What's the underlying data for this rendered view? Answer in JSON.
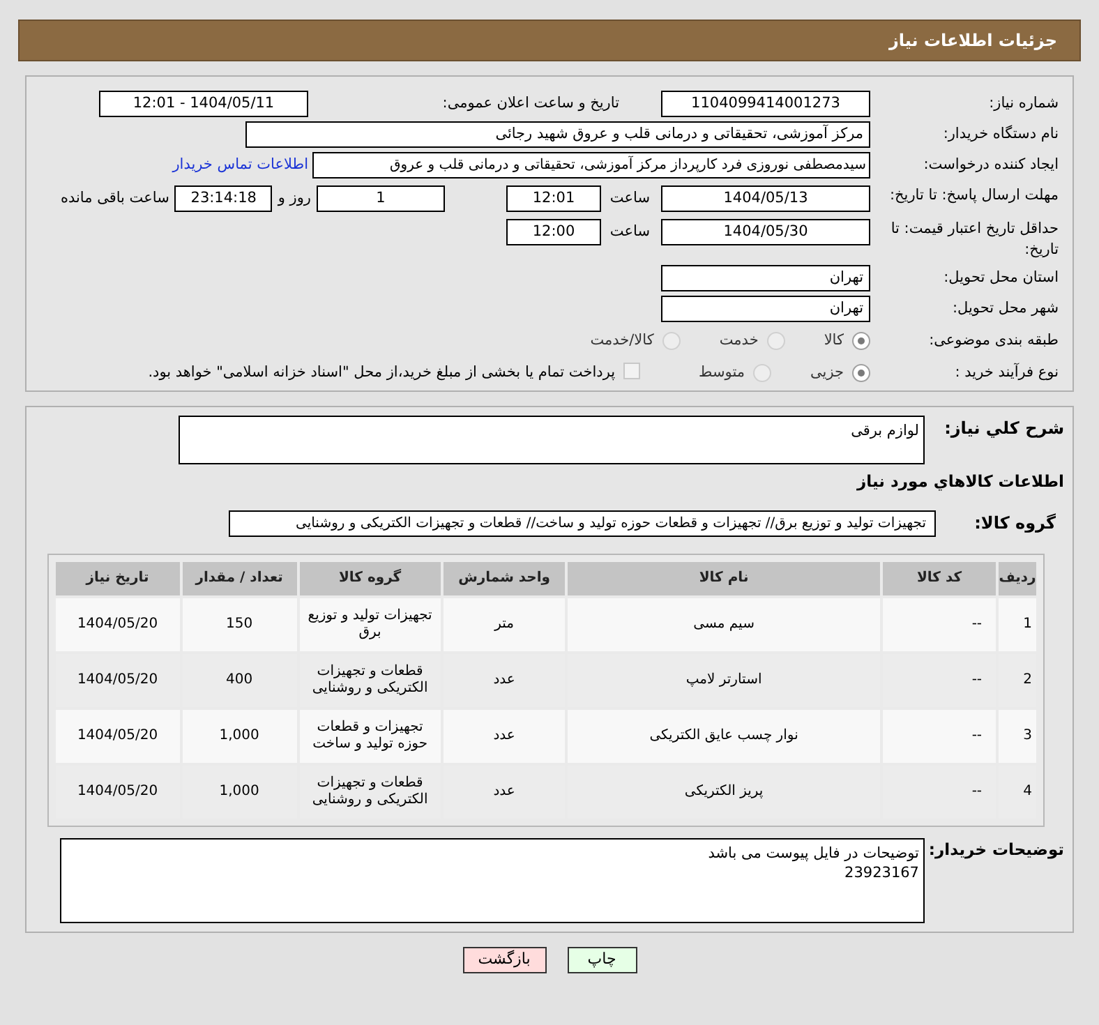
{
  "header": {
    "title": "جزئیات اطلاعات نیاز"
  },
  "need_number": {
    "label": "شماره نیاز:",
    "value": "1104099414001273"
  },
  "announce": {
    "label": "تاریخ و ساعت اعلان عمومی:",
    "value": "1404/05/11 - 12:01"
  },
  "buyer_org": {
    "label": "نام دستگاه خریدار:",
    "value": "مرکز آموزشی، تحقیقاتی و درمانی قلب و عروق شهید رجائی"
  },
  "requester": {
    "label": "ایجاد کننده درخواست:",
    "value": "سیدمصطفی نوروزی فرد کارپرداز مرکز آموزشی، تحقیقاتی و درمانی قلب و عروق",
    "link": "اطلاعات تماس خریدار"
  },
  "reply_deadline": {
    "label": "مهلت ارسال پاسخ: تا تاریخ:",
    "date": "1404/05/13",
    "time_label": "ساعت",
    "time": "12:01",
    "days": "1",
    "days_label": "روز و",
    "remaining": "23:14:18",
    "remaining_label": "ساعت باقی مانده"
  },
  "price_validity": {
    "label": "حداقل تاریخ اعتبار قیمت: تا تاریخ:",
    "date": "1404/05/30",
    "time_label": "ساعت",
    "time": "12:00"
  },
  "province": {
    "label": "استان محل تحویل:",
    "value": "تهران"
  },
  "city": {
    "label": "شهر محل تحویل:",
    "value": "تهران"
  },
  "category": {
    "label": "طبقه بندی موضوعی:",
    "options": [
      {
        "label": "کالا",
        "selected": true
      },
      {
        "label": "خدمت",
        "selected": false
      },
      {
        "label": "کالا/خدمت",
        "selected": false
      }
    ]
  },
  "purchase_process": {
    "label": "نوع فرآیند خرید :",
    "options": [
      {
        "label": "جزیی",
        "selected": true
      },
      {
        "label": "متوسط",
        "selected": false
      }
    ],
    "note": {
      "label": "پرداخت تمام یا بخشی از مبلغ خرید،از محل \"اسناد خزانه اسلامی\" خواهد بود.",
      "checked": false
    }
  },
  "description": {
    "label": "شرح كلي نياز:",
    "value": "لوازم برقی"
  },
  "goods_title": "اطلاعات كالاهاي مورد نياز",
  "goods_group": {
    "label": "گروه کالا:",
    "value": "تجهیزات تولید و توزیع برق// تجهیزات و قطعات حوزه تولید و ساخت// قطعات و تجهیزات الکتریکی و روشنایی"
  },
  "table": {
    "columns": [
      "ردیف",
      "کد کالا",
      "نام کالا",
      "واحد شمارش",
      "گروه کالا",
      "تعداد / مقدار",
      "تاریخ نیاز"
    ],
    "rows": [
      [
        "1",
        "--",
        "سیم مسی",
        "متر",
        "تجهیزات تولید و توزیع برق",
        "150",
        "1404/05/20"
      ],
      [
        "2",
        "--",
        "استارتر لامپ",
        "عدد",
        "قطعات و تجهیزات الکتریکی و روشنایی",
        "400",
        "1404/05/20"
      ],
      [
        "3",
        "--",
        "نوار چسب عایق الکتریکی",
        "عدد",
        "تجهیزات و قطعات حوزه تولید و ساخت",
        "1,000",
        "1404/05/20"
      ],
      [
        "4",
        "--",
        "پریز الکتریکی",
        "عدد",
        "قطعات و تجهیزات الکتریکی و روشنایی",
        "1,000",
        "1404/05/20"
      ]
    ]
  },
  "buyer_notes": {
    "label": "توضیحات خریدار:",
    "lines": [
      "توضیحات در فایل پیوست می باشد",
      "23923167"
    ]
  },
  "buttons": [
    {
      "label": "چاپ",
      "kind": "print"
    },
    {
      "label": "بازگشت",
      "kind": "back"
    }
  ]
}
